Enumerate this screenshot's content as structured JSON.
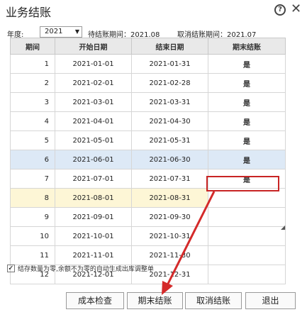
{
  "window": {
    "title": "业务结账",
    "help_icon": "help-icon",
    "close_icon": "close-icon"
  },
  "filter": {
    "year_label": "年度:",
    "year_value": "2021",
    "pending_text": "待结账期间：2021.08",
    "cancel_text": "取消结账期间：2021.07"
  },
  "table": {
    "headers": [
      "期间",
      "开始日期",
      "结束日期",
      "期末结账"
    ],
    "rows": [
      {
        "period": "1",
        "start": "2021-01-01",
        "end": "2021-01-31",
        "closed": "是"
      },
      {
        "period": "2",
        "start": "2021-02-01",
        "end": "2021-02-28",
        "closed": "是"
      },
      {
        "period": "3",
        "start": "2021-03-01",
        "end": "2021-03-31",
        "closed": "是"
      },
      {
        "period": "4",
        "start": "2021-04-01",
        "end": "2021-04-30",
        "closed": "是"
      },
      {
        "period": "5",
        "start": "2021-05-01",
        "end": "2021-05-31",
        "closed": "是"
      },
      {
        "period": "6",
        "start": "2021-06-01",
        "end": "2021-06-30",
        "closed": "是"
      },
      {
        "period": "7",
        "start": "2021-07-01",
        "end": "2021-07-31",
        "closed": "是"
      },
      {
        "period": "8",
        "start": "2021-08-01",
        "end": "2021-08-31",
        "closed": ""
      },
      {
        "period": "9",
        "start": "2021-09-01",
        "end": "2021-09-30",
        "closed": ""
      },
      {
        "period": "10",
        "start": "2021-10-01",
        "end": "2021-10-31",
        "closed": ""
      },
      {
        "period": "11",
        "start": "2021-11-01",
        "end": "2021-11-30",
        "closed": ""
      },
      {
        "period": "12",
        "start": "2021-12-01",
        "end": "2021-12-31",
        "closed": ""
      }
    ]
  },
  "footer": {
    "checkbox_checked": true,
    "checkbox_label": "结存数量为零,余额不为零的自动生成出库调整单"
  },
  "buttons": {
    "cost_check": "成本检查",
    "period_close": "期末结账",
    "cancel_close": "取消结账",
    "exit": "退出"
  },
  "colors": {
    "highlight": "#c82424",
    "arrow": "#d42a2a",
    "selected_row": "#dde9f6",
    "current_row": "#fdf6d6"
  }
}
